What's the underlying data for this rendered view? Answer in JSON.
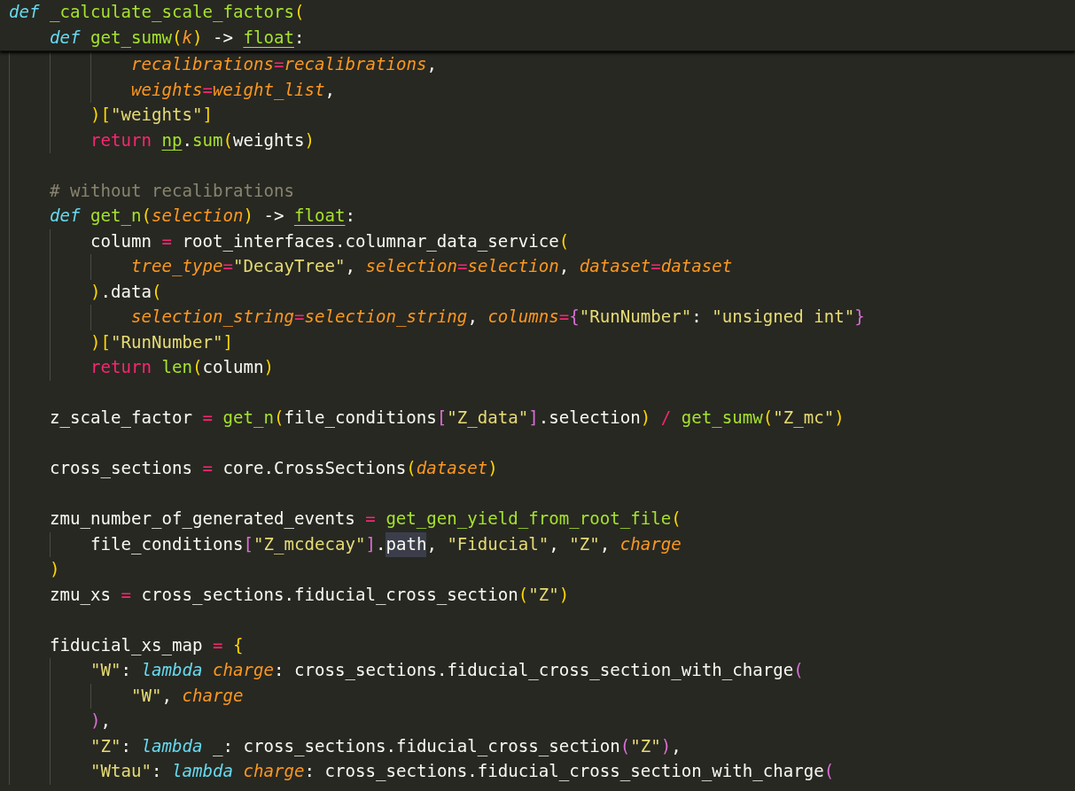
{
  "sticky_scroll": {
    "lines": [
      {
        "kind": "code",
        "tokens": [
          {
            "kind": "kw",
            "text": "def "
          },
          {
            "kind": "fn",
            "text": "_calculate_scale_factors"
          },
          {
            "kind": "b1",
            "text": "("
          }
        ],
        "children": [
          {
            "kind": "code",
            "tokens": [
              {
                "kind": "kw",
                "text": "def "
              },
              {
                "kind": "fn",
                "text": "get_sumw"
              },
              {
                "kind": "b1",
                "text": "("
              },
              {
                "kind": "param",
                "text": "k"
              },
              {
                "kind": "b1",
                "text": ")"
              },
              {
                "kind": "plain",
                "text": " -> "
              },
              {
                "kind": "type",
                "text": "float"
              },
              {
                "kind": "plain",
                "text": ":"
              }
            ]
          }
        ]
      }
    ]
  },
  "editor": {
    "lines": [
      {
        "kind": "block",
        "children": [
          {
            "kind": "block",
            "children": [
              {
                "kind": "block",
                "children": [
                  {
                    "kind": "code",
                    "tokens": [
                      {
                        "kind": "param",
                        "text": "recalibrations"
                      },
                      {
                        "kind": "op",
                        "text": "="
                      },
                      {
                        "kind": "param",
                        "text": "recalibrations"
                      },
                      {
                        "kind": "plain",
                        "text": ","
                      }
                    ]
                  },
                  {
                    "kind": "code",
                    "tokens": [
                      {
                        "kind": "param",
                        "text": "weights"
                      },
                      {
                        "kind": "op",
                        "text": "="
                      },
                      {
                        "kind": "param",
                        "text": "weight_list"
                      },
                      {
                        "kind": "plain",
                        "text": ","
                      }
                    ]
                  }
                ]
              },
              {
                "kind": "code",
                "tokens": [
                  {
                    "kind": "b1",
                    "text": ")"
                  },
                  {
                    "kind": "b1",
                    "text": "["
                  },
                  {
                    "kind": "str",
                    "text": "\"weights\""
                  },
                  {
                    "kind": "b1",
                    "text": "]"
                  }
                ]
              },
              {
                "kind": "code",
                "tokens": [
                  {
                    "kind": "ctrl",
                    "text": "return "
                  },
                  {
                    "kind": "type",
                    "text": "np"
                  },
                  {
                    "kind": "plain",
                    "text": "."
                  },
                  {
                    "kind": "fn",
                    "text": "sum"
                  },
                  {
                    "kind": "b1",
                    "text": "("
                  },
                  {
                    "kind": "plain",
                    "text": "weights"
                  },
                  {
                    "kind": "b1",
                    "text": ")"
                  }
                ]
              }
            ]
          },
          {
            "kind": "blank"
          },
          {
            "kind": "code",
            "tokens": [
              {
                "kind": "comment",
                "text": "# without recalibrations"
              }
            ]
          },
          {
            "kind": "code",
            "tokens": [
              {
                "kind": "kw",
                "text": "def "
              },
              {
                "kind": "fn",
                "text": "get_n"
              },
              {
                "kind": "b1",
                "text": "("
              },
              {
                "kind": "param",
                "text": "selection"
              },
              {
                "kind": "b1",
                "text": ")"
              },
              {
                "kind": "plain",
                "text": " -> "
              },
              {
                "kind": "type",
                "text": "float"
              },
              {
                "kind": "plain",
                "text": ":"
              }
            ],
            "children": [
              {
                "kind": "code",
                "tokens": [
                  {
                    "kind": "plain",
                    "text": "column"
                  },
                  {
                    "kind": "op",
                    "text": " = "
                  },
                  {
                    "kind": "plain",
                    "text": "root_interfaces.columnar_data_service"
                  },
                  {
                    "kind": "b1",
                    "text": "("
                  }
                ],
                "children": [
                  {
                    "kind": "code",
                    "tokens": [
                      {
                        "kind": "param",
                        "text": "tree_type"
                      },
                      {
                        "kind": "op",
                        "text": "="
                      },
                      {
                        "kind": "str",
                        "text": "\"DecayTree\""
                      },
                      {
                        "kind": "plain",
                        "text": ", "
                      },
                      {
                        "kind": "param",
                        "text": "selection"
                      },
                      {
                        "kind": "op",
                        "text": "="
                      },
                      {
                        "kind": "param",
                        "text": "selection"
                      },
                      {
                        "kind": "plain",
                        "text": ", "
                      },
                      {
                        "kind": "param",
                        "text": "dataset"
                      },
                      {
                        "kind": "op",
                        "text": "="
                      },
                      {
                        "kind": "param",
                        "text": "dataset"
                      }
                    ]
                  }
                ]
              },
              {
                "kind": "code",
                "tokens": [
                  {
                    "kind": "b1",
                    "text": ")"
                  },
                  {
                    "kind": "plain",
                    "text": ".data"
                  },
                  {
                    "kind": "b1",
                    "text": "("
                  }
                ],
                "children": [
                  {
                    "kind": "code",
                    "tokens": [
                      {
                        "kind": "param",
                        "text": "selection_string"
                      },
                      {
                        "kind": "op",
                        "text": "="
                      },
                      {
                        "kind": "param",
                        "text": "selection_string"
                      },
                      {
                        "kind": "plain",
                        "text": ", "
                      },
                      {
                        "kind": "param",
                        "text": "columns"
                      },
                      {
                        "kind": "op",
                        "text": "="
                      },
                      {
                        "kind": "b2",
                        "text": "{"
                      },
                      {
                        "kind": "str",
                        "text": "\"RunNumber\""
                      },
                      {
                        "kind": "plain",
                        "text": ": "
                      },
                      {
                        "kind": "str",
                        "text": "\"unsigned int\""
                      },
                      {
                        "kind": "b2",
                        "text": "}"
                      }
                    ]
                  }
                ]
              },
              {
                "kind": "code",
                "tokens": [
                  {
                    "kind": "b1",
                    "text": ")"
                  },
                  {
                    "kind": "b1",
                    "text": "["
                  },
                  {
                    "kind": "str",
                    "text": "\"RunNumber\""
                  },
                  {
                    "kind": "b1",
                    "text": "]"
                  }
                ]
              },
              {
                "kind": "code",
                "tokens": [
                  {
                    "kind": "ctrl",
                    "text": "return "
                  },
                  {
                    "kind": "fn",
                    "text": "len"
                  },
                  {
                    "kind": "b1",
                    "text": "("
                  },
                  {
                    "kind": "plain",
                    "text": "column"
                  },
                  {
                    "kind": "b1",
                    "text": ")"
                  }
                ]
              }
            ]
          },
          {
            "kind": "blank"
          },
          {
            "kind": "code",
            "tokens": [
              {
                "kind": "plain",
                "text": "z_scale_factor"
              },
              {
                "kind": "op",
                "text": " = "
              },
              {
                "kind": "fn",
                "text": "get_n"
              },
              {
                "kind": "b1",
                "text": "("
              },
              {
                "kind": "plain",
                "text": "file_conditions"
              },
              {
                "kind": "b2",
                "text": "["
              },
              {
                "kind": "str",
                "text": "\"Z_data\""
              },
              {
                "kind": "b2",
                "text": "]"
              },
              {
                "kind": "plain",
                "text": ".selection"
              },
              {
                "kind": "b1",
                "text": ")"
              },
              {
                "kind": "op",
                "text": " / "
              },
              {
                "kind": "fn",
                "text": "get_sumw"
              },
              {
                "kind": "b1",
                "text": "("
              },
              {
                "kind": "str",
                "text": "\"Z_mc\""
              },
              {
                "kind": "b1",
                "text": ")"
              }
            ]
          },
          {
            "kind": "blank"
          },
          {
            "kind": "code",
            "tokens": [
              {
                "kind": "plain",
                "text": "cross_sections"
              },
              {
                "kind": "op",
                "text": " = "
              },
              {
                "kind": "plain",
                "text": "core.CrossSections"
              },
              {
                "kind": "b1",
                "text": "("
              },
              {
                "kind": "param",
                "text": "dataset"
              },
              {
                "kind": "b1",
                "text": ")"
              }
            ]
          },
          {
            "kind": "blank"
          },
          {
            "kind": "code",
            "tokens": [
              {
                "kind": "plain",
                "text": "zmu_number_of_generated_events"
              },
              {
                "kind": "op",
                "text": " = "
              },
              {
                "kind": "fn",
                "text": "get_gen_yield_from_root_file"
              },
              {
                "kind": "b1",
                "text": "("
              }
            ],
            "children": [
              {
                "kind": "code",
                "tokens": [
                  {
                    "kind": "plain",
                    "text": "file_conditions"
                  },
                  {
                    "kind": "b2",
                    "text": "["
                  },
                  {
                    "kind": "str",
                    "text": "\"Z_mcdecay\""
                  },
                  {
                    "kind": "b2",
                    "text": "]"
                  },
                  {
                    "kind": "plain",
                    "text": "."
                  },
                  {
                    "kind": "plain",
                    "text": "path",
                    "highlighted": true
                  },
                  {
                    "kind": "plain",
                    "text": ", "
                  },
                  {
                    "kind": "str",
                    "text": "\"Fiducial\""
                  },
                  {
                    "kind": "plain",
                    "text": ", "
                  },
                  {
                    "kind": "str",
                    "text": "\"Z\""
                  },
                  {
                    "kind": "plain",
                    "text": ", "
                  },
                  {
                    "kind": "param",
                    "text": "charge"
                  }
                ]
              }
            ]
          },
          {
            "kind": "code",
            "tokens": [
              {
                "kind": "b1",
                "text": ")"
              }
            ]
          },
          {
            "kind": "code",
            "tokens": [
              {
                "kind": "plain",
                "text": "zmu_xs"
              },
              {
                "kind": "op",
                "text": " = "
              },
              {
                "kind": "plain",
                "text": "cross_sections.fiducial_cross_section"
              },
              {
                "kind": "b1",
                "text": "("
              },
              {
                "kind": "str",
                "text": "\"Z\""
              },
              {
                "kind": "b1",
                "text": ")"
              }
            ]
          },
          {
            "kind": "blank"
          },
          {
            "kind": "code",
            "tokens": [
              {
                "kind": "plain",
                "text": "fiducial_xs_map"
              },
              {
                "kind": "op",
                "text": " = "
              },
              {
                "kind": "b1",
                "text": "{"
              }
            ],
            "children": [
              {
                "kind": "code",
                "tokens": [
                  {
                    "kind": "str",
                    "text": "\"W\""
                  },
                  {
                    "kind": "plain",
                    "text": ": "
                  },
                  {
                    "kind": "kw",
                    "text": "lambda "
                  },
                  {
                    "kind": "param",
                    "text": "charge"
                  },
                  {
                    "kind": "plain",
                    "text": ": cross_sections.fiducial_cross_section_with_charge"
                  },
                  {
                    "kind": "b2",
                    "text": "("
                  }
                ],
                "children": [
                  {
                    "kind": "code",
                    "tokens": [
                      {
                        "kind": "str",
                        "text": "\"W\""
                      },
                      {
                        "kind": "plain",
                        "text": ", "
                      },
                      {
                        "kind": "param",
                        "text": "charge"
                      }
                    ]
                  }
                ]
              },
              {
                "kind": "code",
                "tokens": [
                  {
                    "kind": "b2",
                    "text": ")"
                  },
                  {
                    "kind": "plain",
                    "text": ","
                  }
                ]
              },
              {
                "kind": "code",
                "tokens": [
                  {
                    "kind": "str",
                    "text": "\"Z\""
                  },
                  {
                    "kind": "plain",
                    "text": ": "
                  },
                  {
                    "kind": "kw",
                    "text": "lambda "
                  },
                  {
                    "kind": "plain",
                    "text": "_: cross_sections.fiducial_cross_section"
                  },
                  {
                    "kind": "b2",
                    "text": "("
                  },
                  {
                    "kind": "str",
                    "text": "\"Z\""
                  },
                  {
                    "kind": "b2",
                    "text": ")"
                  },
                  {
                    "kind": "plain",
                    "text": ","
                  }
                ]
              },
              {
                "kind": "code",
                "tokens": [
                  {
                    "kind": "str",
                    "text": "\"Wtau\""
                  },
                  {
                    "kind": "plain",
                    "text": ": "
                  },
                  {
                    "kind": "kw",
                    "text": "lambda "
                  },
                  {
                    "kind": "param",
                    "text": "charge"
                  },
                  {
                    "kind": "plain",
                    "text": ": cross_sections.fiducial_cross_section_with_charge"
                  },
                  {
                    "kind": "b2",
                    "text": "("
                  }
                ]
              }
            ]
          }
        ]
      }
    ]
  }
}
